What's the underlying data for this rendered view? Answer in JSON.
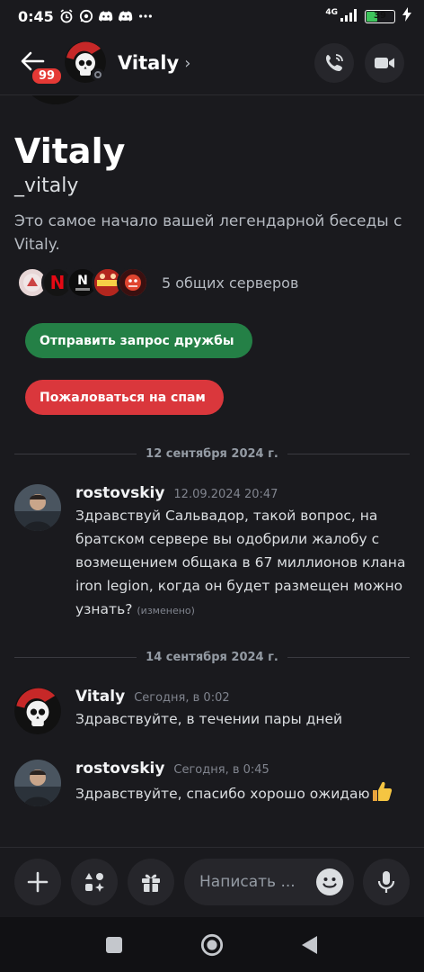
{
  "status_bar": {
    "time": "0:45",
    "network": "4G",
    "battery": "39",
    "icons": [
      "alarm-icon",
      "whatsapp-icon",
      "discord-icon",
      "discord-icon",
      "more-dots-icon"
    ]
  },
  "header": {
    "badge": "99",
    "title": "Vitaly",
    "chevron": "›",
    "actions": [
      "voice-call-icon",
      "video-call-icon"
    ]
  },
  "profile": {
    "display_name": "Vitaly",
    "username": "_vitaly",
    "intro": "Это самое начало вашей легендарной беседы с Vitaly.",
    "mutual_servers_label": "5 общих серверов",
    "mutual_servers": [
      "server-1",
      "netflix-red",
      "bug-hunter",
      "capt-transformers",
      "server-5"
    ],
    "friend_request_button": "Отправить запрос дружбы",
    "report_spam_button": "Пожаловаться на спам"
  },
  "messages": [
    {
      "divider": "12 сентября 2024 г.",
      "author": "rostovskiy",
      "time": "12.09.2024 20:47",
      "text": "Здравствуй Сальвадор, такой вопрос, на братском сервере вы одобрили жалобу с возмещением общака в 67 миллионов клана iron legion, когда он будет размещен можно узнать?",
      "edited": "(изменено)"
    },
    {
      "divider": "14 сентября 2024 г.",
      "author": "Vitaly",
      "time": "Сегодня, в 0:02",
      "text": "Здравствуйте, в течении пары дней"
    },
    {
      "author": "rostovskiy",
      "time": "Сегодня, в 0:45",
      "text": "Здравствуйте, спасибо хорошо ожидаю",
      "emoji": "thumbs-up"
    }
  ],
  "composer": {
    "placeholder": "Написать ...",
    "buttons": [
      "plus-icon",
      "apps-icon",
      "gift-icon",
      "emoji-icon",
      "microphone-icon"
    ]
  },
  "navbar": [
    "recents-square-icon",
    "home-circle-icon",
    "back-triangle-icon"
  ],
  "colors": {
    "background": "#1a1a1e",
    "green": "#248046",
    "red": "#da373c",
    "badge": "#e53935"
  }
}
